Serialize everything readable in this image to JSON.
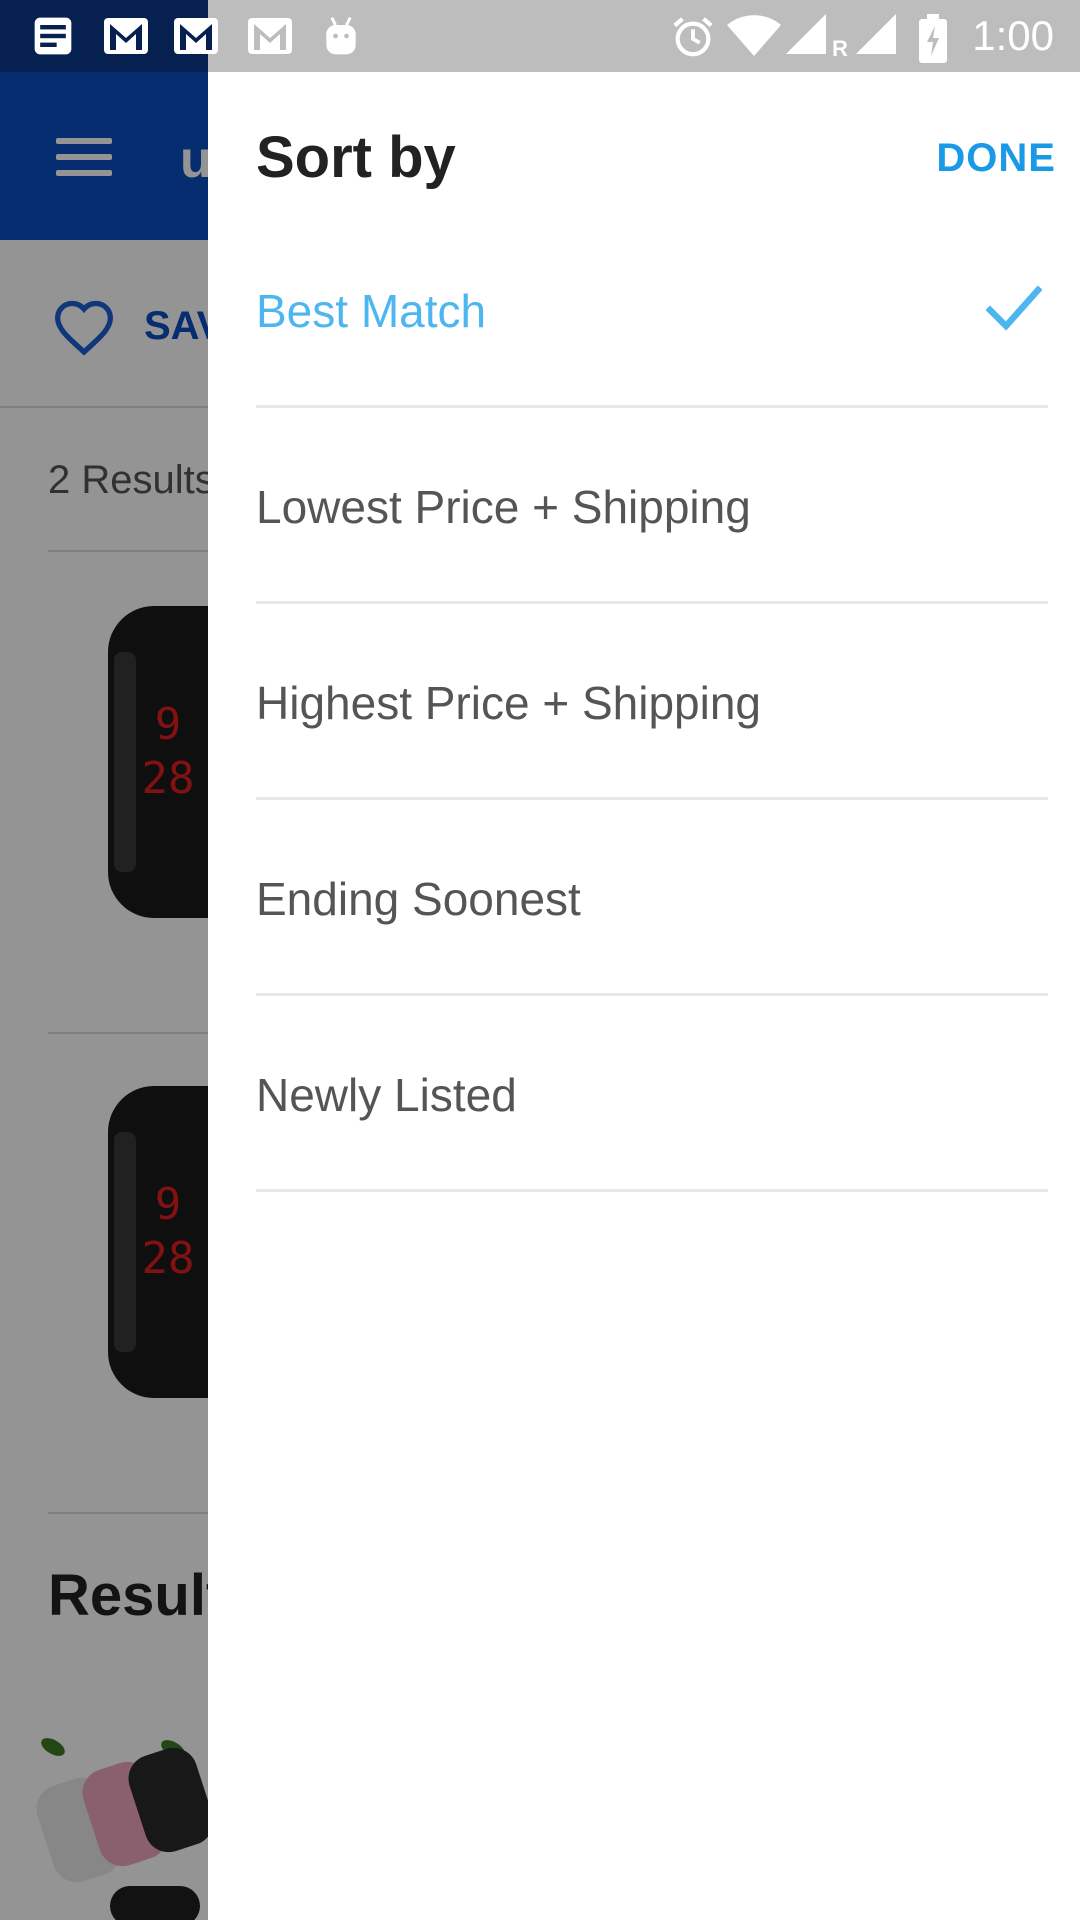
{
  "status_bar": {
    "time": "1:00",
    "left_icons": [
      "news-icon",
      "gmail-icon",
      "gmail-icon",
      "gmail-icon",
      "android-icon"
    ],
    "right_icons": [
      "alarm-icon",
      "wifi-icon",
      "signal-roaming-icon",
      "signal-icon",
      "battery-charging-icon"
    ],
    "roaming_mark": "R"
  },
  "background_app": {
    "logo_text": "u",
    "save_label": "SAV",
    "results_count": "2 Results",
    "watch_digits_top": "9",
    "watch_digits_bottom": "28",
    "results_heading": "Result",
    "brand_color": "#0a4fbf"
  },
  "sort_sheet": {
    "title": "Sort by",
    "done_label": "DONE",
    "accent_color": "#1a9ae6",
    "selected_color": "#4db6f0",
    "options": [
      {
        "label": "Best Match",
        "selected": true
      },
      {
        "label": "Lowest Price + Shipping",
        "selected": false
      },
      {
        "label": "Highest Price + Shipping",
        "selected": false
      },
      {
        "label": "Ending Soonest",
        "selected": false
      },
      {
        "label": "Newly Listed",
        "selected": false
      }
    ]
  }
}
